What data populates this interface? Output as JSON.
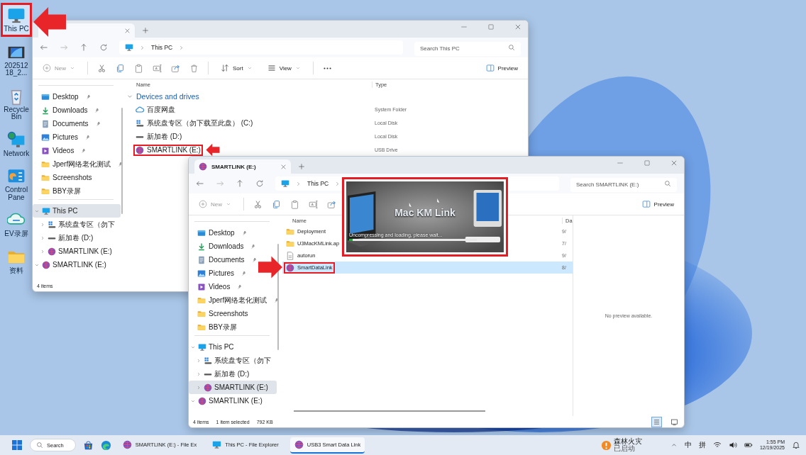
{
  "desktop_icons": [
    {
      "label": "This PC",
      "kind": "pc",
      "selected": true,
      "highlighted": true
    },
    {
      "label": "20251218_2...",
      "kind": "videothumb",
      "selected": false,
      "highlighted": false
    },
    {
      "label": "Recycle Bin",
      "kind": "recycle",
      "selected": false,
      "highlighted": false
    },
    {
      "label": "Network",
      "kind": "network",
      "selected": false,
      "highlighted": false
    },
    {
      "label": "Control Pane",
      "kind": "control",
      "selected": false,
      "highlighted": false
    },
    {
      "label": "EV录屏",
      "kind": "ev",
      "selected": false,
      "highlighted": false
    },
    {
      "label": "资料",
      "kind": "folder",
      "selected": false,
      "highlighted": false
    }
  ],
  "windows": [
    {
      "tab": {
        "selected": true
      },
      "address": [
        "This PC"
      ],
      "search": {
        "placeholder": "Search This PC"
      },
      "toolbar": [
        {
          "kind": "new",
          "label": "New",
          "disabled": true
        },
        {
          "kind": "separator"
        },
        {
          "kind": "cut"
        },
        {
          "kind": "copy"
        },
        {
          "kind": "paste"
        },
        {
          "kind": "rename"
        },
        {
          "kind": "share"
        },
        {
          "kind": "delete"
        },
        {
          "kind": "separator"
        },
        {
          "kind": "sort",
          "label": "Sort"
        },
        {
          "kind": "view",
          "label": "View"
        },
        {
          "kind": "separator"
        },
        {
          "kind": "more"
        }
      ],
      "preview_button": "Preview",
      "sidebar": {
        "quick": [
          {
            "label": "Desktop",
            "kind": "desktop",
            "pinned": true
          },
          {
            "label": "Downloads",
            "kind": "download",
            "pinned": true
          },
          {
            "label": "Documents",
            "kind": "document",
            "pinned": true
          },
          {
            "label": "Pictures",
            "kind": "picture",
            "pinned": true
          },
          {
            "label": "Videos",
            "kind": "video",
            "pinned": true
          },
          {
            "label": "Jperf网络老化测试",
            "kind": "folder",
            "pinned": true
          },
          {
            "label": "Screenshots",
            "kind": "folder",
            "pinned": false
          },
          {
            "label": "BBY录屏",
            "kind": "folder",
            "pinned": false
          }
        ],
        "tree": [
          {
            "label": "This PC",
            "kind": "pc",
            "expanded": true,
            "selected": true,
            "children": [
              {
                "label": "系统盘专区（勿下",
                "kind": "windrive",
                "expanded": false,
                "selected": false
              },
              {
                "label": "新加卷 (D:)",
                "kind": "drive",
                "expanded": false,
                "selected": false
              },
              {
                "label": "SMARTLINK (E:)",
                "kind": "usb",
                "expanded": false,
                "selected": false
              }
            ]
          },
          {
            "label": "SMARTLINK (E:)",
            "kind": "usb",
            "expanded": true,
            "selected": false
          }
        ]
      },
      "columns": [
        "Name",
        "Type"
      ],
      "group": {
        "label": "Devices and drives",
        "expanded": true
      },
      "rows": [
        {
          "name": "百度网盘",
          "kind": "cloud",
          "detail": "System Folder",
          "selected": false,
          "highlighted": false
        },
        {
          "name": "系统盘专区（勿下载至此盘） (C:)",
          "kind": "windrive",
          "detail": "Local Disk",
          "selected": false,
          "highlighted": false
        },
        {
          "name": "新加卷 (D:)",
          "kind": "drive",
          "detail": "Local Disk",
          "selected": false,
          "highlighted": false
        },
        {
          "name": "SMARTLINK (E:)",
          "kind": "usb",
          "detail": "USB Drive",
          "selected": false,
          "highlighted": true
        }
      ],
      "status": [
        "4 items"
      ]
    },
    {
      "tab": {
        "kind": "usb",
        "label": "SMARTLINK (E:)",
        "selected": true
      },
      "address": [
        "This PC"
      ],
      "search": {
        "placeholder": "Search SMARTLINK (E:)"
      },
      "toolbar": [
        {
          "kind": "new",
          "label": "New",
          "disabled": true
        },
        {
          "kind": "separator"
        },
        {
          "kind": "cut"
        },
        {
          "kind": "copy"
        },
        {
          "kind": "paste"
        },
        {
          "kind": "rename"
        },
        {
          "kind": "share"
        }
      ],
      "preview_button": "Preview",
      "sidebar": {
        "quick": [
          {
            "label": "Desktop",
            "kind": "desktop",
            "pinned": true
          },
          {
            "label": "Downloads",
            "kind": "download",
            "pinned": true
          },
          {
            "label": "Documents",
            "kind": "document",
            "pinned": true
          },
          {
            "label": "Pictures",
            "kind": "picture",
            "pinned": true
          },
          {
            "label": "Videos",
            "kind": "video",
            "pinned": true
          },
          {
            "label": "Jperf网络老化测试",
            "kind": "folder",
            "pinned": true
          },
          {
            "label": "Screenshots",
            "kind": "folder",
            "pinned": false
          },
          {
            "label": "BBY录屏",
            "kind": "folder",
            "pinned": false
          }
        ],
        "tree": [
          {
            "label": "This PC",
            "kind": "pc",
            "expanded": true,
            "selected": false,
            "children": [
              {
                "label": "系统盘专区（勿下",
                "kind": "windrive",
                "expanded": false,
                "selected": false
              },
              {
                "label": "新加卷 (D:)",
                "kind": "drive",
                "expanded": false,
                "selected": false
              },
              {
                "label": "SMARTLINK (E:)",
                "kind": "usb",
                "expanded": false,
                "selected": true
              }
            ]
          },
          {
            "label": "SMARTLINK (E:)",
            "kind": "usb",
            "expanded": true,
            "selected": false
          }
        ]
      },
      "columns": [
        "Name",
        "Da"
      ],
      "rows": [
        {
          "name": "Deployment",
          "kind": "folder",
          "detail": "9/",
          "selected": false,
          "highlighted": false
        },
        {
          "name": "U3MacKMLink.ap",
          "kind": "folder",
          "detail": "7/",
          "selected": false,
          "highlighted": false
        },
        {
          "name": "autorun",
          "kind": "file",
          "detail": "9/",
          "selected": false,
          "highlighted": false
        },
        {
          "name": "SmartDataLink",
          "kind": "usb",
          "detail": "8/",
          "selected": true,
          "highlighted": true
        }
      ],
      "preview_text": "No preview available.",
      "status": [
        "4 items",
        "1 item selected",
        "792 KB"
      ],
      "view_toggle": [
        {
          "kind": "details",
          "selected": true
        },
        {
          "kind": "tiles",
          "selected": false
        }
      ]
    }
  ],
  "splash": {
    "title": "Mac KM Link",
    "message": "Uncompressing and loading, please wait...",
    "level": 0.03,
    "highlighted": true
  },
  "taskbar": {
    "search": "Search",
    "apps": [
      {
        "label": "SMARTLINK (E:) - File Ex",
        "kind": "usb",
        "active": false
      },
      {
        "label": "This PC - File Explorer",
        "kind": "pc",
        "active": false
      },
      {
        "label": "USB3 Smart Data Link",
        "kind": "usb",
        "active": true
      }
    ],
    "notification": {
      "title": "森林火灾",
      "subtitle": "已启动"
    },
    "input_indicators": [
      "中",
      "拼"
    ],
    "time": "1:55 PM",
    "date": "12/19/2025"
  }
}
